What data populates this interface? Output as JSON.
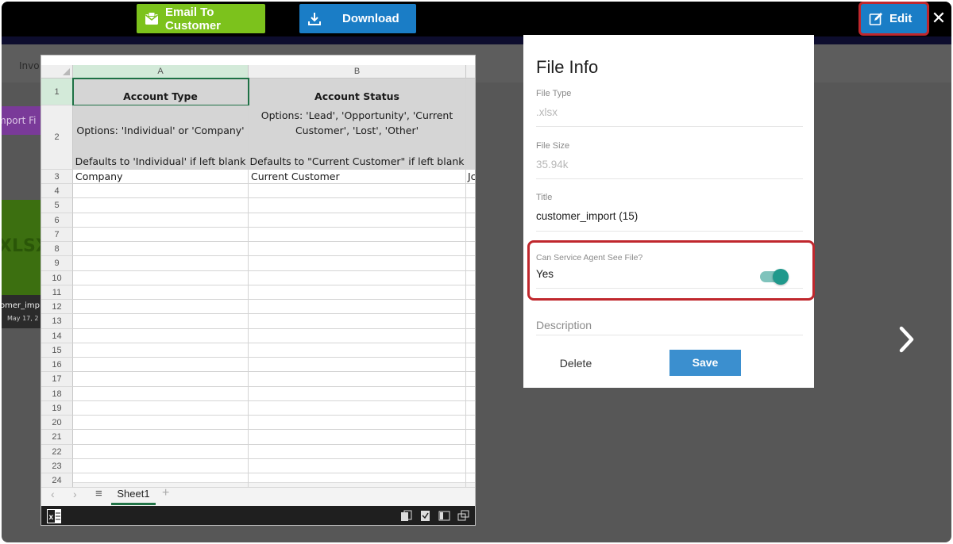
{
  "toolbar": {
    "email_label": "Email To Customer",
    "download_label": "Download",
    "edit_label": "Edit",
    "close_symbol": "✕",
    "colors": {
      "email_bg": "#7cc21c",
      "download_bg": "#1a7dc6",
      "edit_bg": "#1a7dc6",
      "highlight": "#c0272d"
    }
  },
  "background": {
    "nav_text": "Invo",
    "import_button": "mport Fi",
    "thumb_label": "XLSX",
    "thumb_caption": "omer_imp",
    "thumb_date": "May 17, 2"
  },
  "sheet": {
    "columns": [
      "A",
      "B"
    ],
    "row1": {
      "num": "1",
      "a": "Account Type",
      "b": "Account Status"
    },
    "row2": {
      "num": "2",
      "a_line1": "Options: 'Individual' or 'Company'",
      "a_line2": "Defaults to 'Individual' if left blank",
      "b_line1": "Options: 'Lead', 'Opportunity', 'Current",
      "b_line2": "Customer', 'Lost', 'Other'",
      "b_line3": "Defaults to \"Current Customer\" if left blank"
    },
    "row3": {
      "num": "3",
      "a": "Company",
      "b": "Current Customer",
      "c": "Jc"
    },
    "empty_rows": [
      "4",
      "5",
      "6",
      "7",
      "8",
      "9",
      "10",
      "11",
      "12",
      "13",
      "14",
      "15",
      "16",
      "17",
      "18",
      "19",
      "20",
      "21",
      "22",
      "23",
      "24"
    ],
    "tab_name": "Sheet1",
    "menu_icon": "≡",
    "plus_icon": "+"
  },
  "file_info": {
    "title": "File Info",
    "file_type_label": "File Type",
    "file_type_value": ".xlsx",
    "file_size_label": "File Size",
    "file_size_value": "35.94k",
    "title_label": "Title",
    "title_value": "customer_import (15)",
    "visibility_label": "Can Service Agent See File?",
    "visibility_value": "Yes",
    "visibility_on": true,
    "description_label": "Description",
    "delete_label": "Delete",
    "save_label": "Save"
  }
}
